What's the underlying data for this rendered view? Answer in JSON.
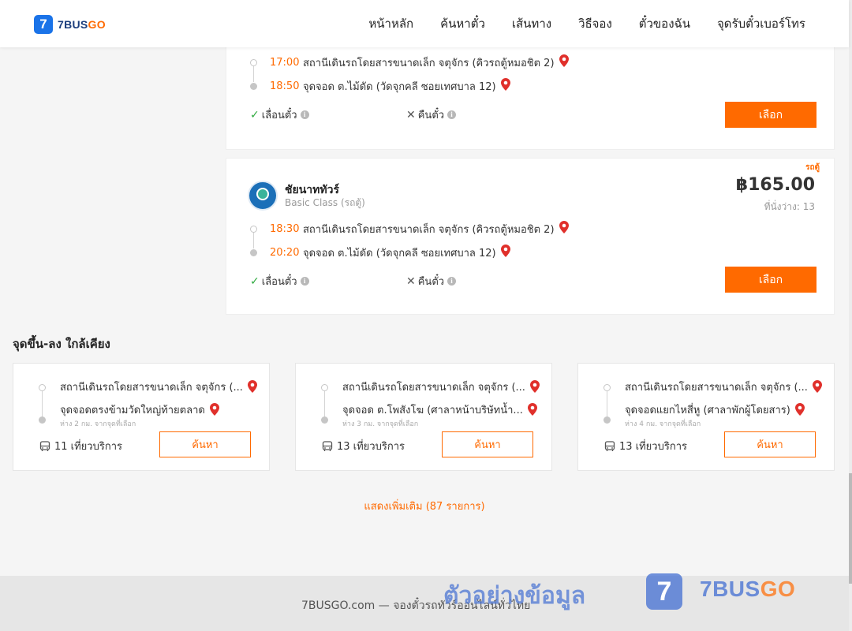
{
  "header": {
    "logo_digit": "7",
    "logo_name_a": "7BUS",
    "logo_name_b": "GO",
    "nav": [
      "หน้าหลัก",
      "ค้นหาตั๋ว",
      "เส้นทาง",
      "วิธีจอง",
      "ตั๋วของฉัน",
      "จุดรับตั๋วเบอร์โทร"
    ]
  },
  "trips": [
    {
      "depart_time": "17:00",
      "depart_place": "สถานีเดินรถโดยสารขนาดเล็ก จตุจักร (คิวรถตู้หมอชิต 2)",
      "arrive_time": "18:50",
      "arrive_place": "จุดจอด ต.ไม้ดัด (วัดจุกคลี ซอยเทศบาล 12)",
      "reschedule_label": "เลื่อนตั๋ว",
      "refund_label": "คืนตั๋ว",
      "select_label": "เลือก"
    },
    {
      "badge": "รถตู้",
      "operator": "ชัยนาททัวร์",
      "class": "Basic Class (รถตู้)",
      "price": "฿165.00",
      "seats": "ที่นั่งว่าง: 13",
      "depart_time": "18:30",
      "depart_place": "สถานีเดินรถโดยสารขนาดเล็ก จตุจักร (คิวรถตู้หมอชิต 2)",
      "arrive_time": "20:20",
      "arrive_place": "จุดจอด ต.ไม้ดัด (วัดจุกคลี ซอยเทศบาล 12)",
      "reschedule_label": "เลื่อนตั๋ว",
      "refund_label": "คืนตั๋ว",
      "select_label": "เลือก"
    }
  ],
  "nearby": {
    "title": "จุดขึ้น-ลง ใกล้เคียง",
    "items": [
      {
        "from": "สถานีเดินรถโดยสารขนาดเล็ก จตุจักร (...",
        "to": "จุดจอดตรงข้ามวัดใหญ่ท้ายตลาด",
        "distance": "ห่าง 2 กม. จากจุดที่เลือก",
        "count": "11 เที่ยวบริการ",
        "search_label": "ค้นหา"
      },
      {
        "from": "สถานีเดินรถโดยสารขนาดเล็ก จตุจักร (...",
        "to": "จุดจอด ต.โพสังโฆ (ศาลาหน้าบริษัทน้ำ...",
        "distance": "ห่าง 3 กม. จากจุดที่เลือก",
        "count": "13 เที่ยวบริการ",
        "search_label": "ค้นหา"
      },
      {
        "from": "สถานีเดินรถโดยสารขนาดเล็ก จตุจักร (...",
        "to": "จุดจอดแยกไหสี่หู (ศาลาพักผู้โดยสาร)",
        "distance": "ห่าง 4 กม. จากจุดที่เลือก",
        "count": "13 เที่ยวบริการ",
        "search_label": "ค้นหา"
      }
    ],
    "show_more": "แสดงเพิ่มเติม (87 รายการ)"
  },
  "footer": {
    "text": "7BUSGO.com — จองตั๋วรถทัวร์ออนไลน์ทั่วไทย",
    "watermark_text": "ตัวอย่างข้อมูล",
    "watermark_digit": "7",
    "watermark_brand_a": "7BUS",
    "watermark_brand_b": "GO"
  },
  "colors": {
    "accent": "#ff6a00",
    "brand_blue": "#1a73e8",
    "check_green": "#2eaa3f"
  },
  "icons": [
    "logo-icon",
    "location-pin-icon",
    "check-icon",
    "close-icon",
    "info-icon",
    "bus-icon",
    "operator-logo-icon"
  ]
}
